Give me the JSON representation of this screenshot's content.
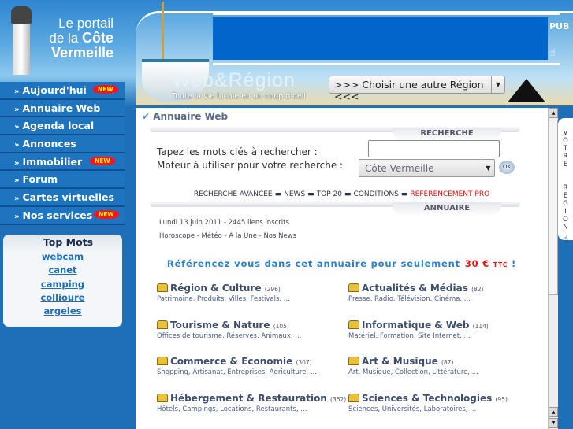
{
  "header": {
    "portal_line1": "Le portail",
    "portal_line2_pre": "de la",
    "portal_line2_bold": "Côte",
    "portal_line3": "Vermeille",
    "logo_text": "Web&Région",
    "tagline": "Toute la vie locale en un coup d'oeil",
    "pub_label": "PUB",
    "region_select": "&gt;&gt;&gt; Choisir une autre Région &lt;&lt;&lt;"
  },
  "sidebar": {
    "items": [
      {
        "label": "Aujourd'hui",
        "badge": "NEW"
      },
      {
        "label": "Annuaire Web"
      },
      {
        "label": "Agenda local"
      },
      {
        "label": "Annonces"
      },
      {
        "label": "Immobilier",
        "badge": "NEW"
      },
      {
        "label": "Forum"
      },
      {
        "label": "Cartes virtuelles"
      },
      {
        "label": "Nos services",
        "badge": "NEW"
      }
    ],
    "top_mots": {
      "title": "Top Mots",
      "words": [
        "webcam",
        "canet",
        "camping",
        "collioure",
        "argeles"
      ]
    }
  },
  "main": {
    "breadcrumb": "Annuaire Web",
    "recherche_tab": "RECHERCHE",
    "keywords_label": "Tapez les mots clés à rechercher :",
    "keywords_value": "",
    "engine_label": "Moteur à utiliser pour votre recherche :",
    "engine_value": "Côte Vermeille",
    "ok_label": "OK",
    "links": [
      "RECHERCHE AVANCEE",
      "NEWS",
      "TOP 20",
      "CONDITIONS",
      "REFERENCEMENT PRO"
    ],
    "annuaire_tab": "ANNUAIRE",
    "date_line": "Lundi 13 juin 2011  - 2445 liens inscrits",
    "subnav": [
      "Horoscope",
      "Météo",
      "A la Une",
      "Nos News"
    ],
    "promo_text": "Référencez vous dans cet annuaire pour seulement",
    "promo_price": "30 €",
    "promo_ttc": "TTC",
    "promo_end": "!",
    "categories": [
      {
        "title": "Région & Culture",
        "count": "(296)",
        "sub": "Patrimoine, Produits, Villes, Festivals, ..."
      },
      {
        "title": "Actualités & Médias",
        "count": "(82)",
        "sub": "Presse, Radio, Télévision, Cinéma, ..."
      },
      {
        "title": "Tourisme & Nature",
        "count": "(105)",
        "sub": "Offices de tourisme, Réserves, Animaux, ..."
      },
      {
        "title": "Informatique & Web",
        "count": "(114)",
        "sub": "Matériel, Formation, Site Internet, ..."
      },
      {
        "title": "Commerce & Economie",
        "count": "(307)",
        "sub": "Shopping, Artisanat, Entreprises, Agriculture, ..."
      },
      {
        "title": "Art & Musique",
        "count": "(87)",
        "sub": "Art, Musique, Collection, Littérature, ..."
      },
      {
        "title": "Hébergement & Restauration",
        "count": "(352)",
        "sub": "Hôtels, Campings, Locations, Restaurants, ..."
      },
      {
        "title": "Sciences & Technologies",
        "count": "(95)",
        "sub": "Sciences, Universités, Laboratoires, ..."
      }
    ]
  },
  "votre_region": "VOTRE REGION",
  "colors": {
    "sidebar": "#1e74bf",
    "ad": "#0066cc",
    "link_red": "#ee1111",
    "promo": "#2a7fd0"
  }
}
